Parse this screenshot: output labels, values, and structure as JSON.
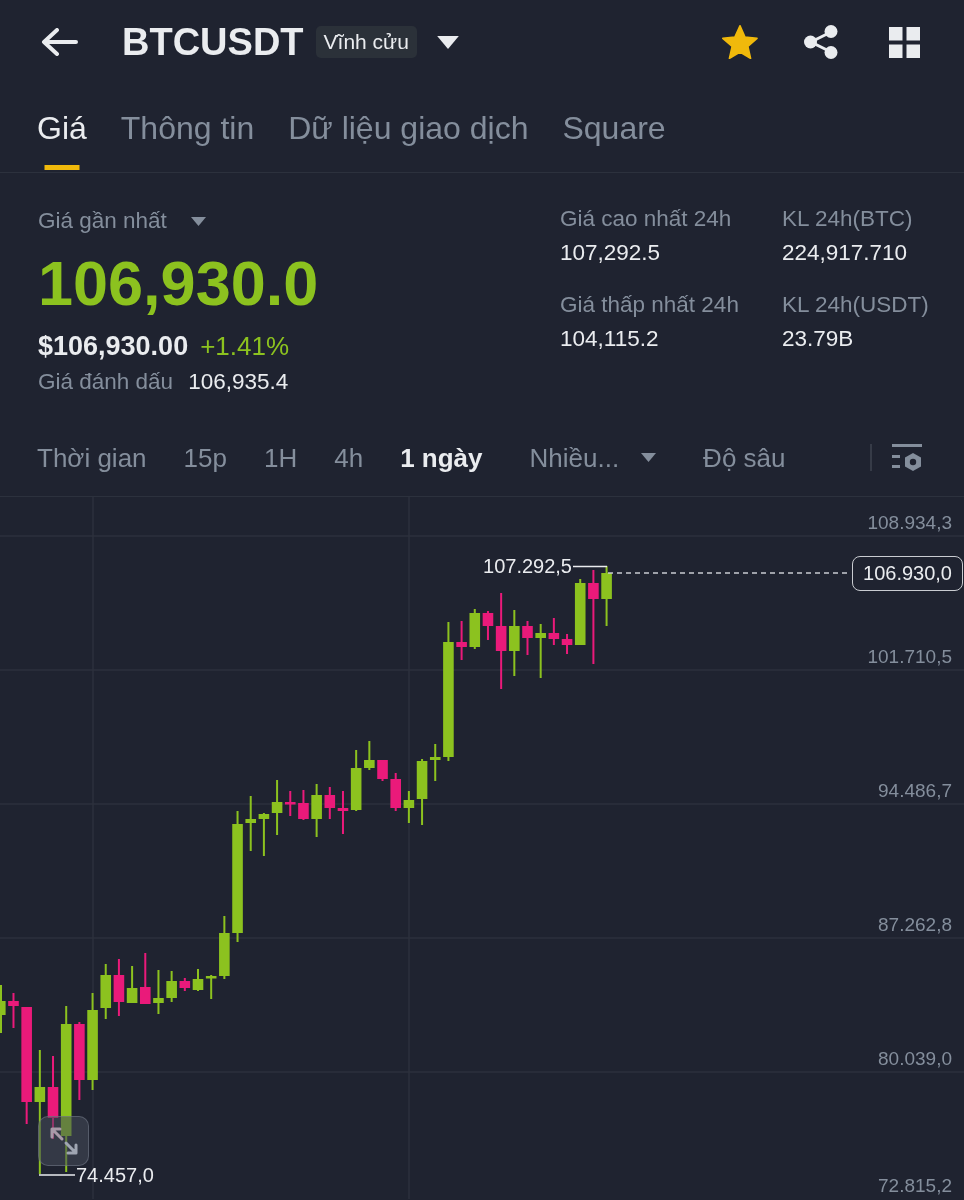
{
  "header": {
    "symbol": "BTCUSDT",
    "contract_type": "Vĩnh cửu",
    "favorite": true
  },
  "tabs": [
    {
      "label": "Giá",
      "selected": true
    },
    {
      "label": "Thông tin",
      "selected": false
    },
    {
      "label": "Dữ liệu giao dịch",
      "selected": false
    },
    {
      "label": "Square",
      "selected": false
    }
  ],
  "price_panel": {
    "last_price_label": "Giá gần nhất",
    "last_price": "106,930.0",
    "usd_price": "$106,930.00",
    "change": "+1.41%",
    "mark_price_label": "Giá đánh dấu",
    "mark_price": "106,935.4"
  },
  "stats": [
    {
      "label": "Giá cao nhất 24h",
      "value": "107,292.5"
    },
    {
      "label": "KL 24h(BTC)",
      "value": "224,917.710"
    },
    {
      "label": "Giá thấp nhất 24h",
      "value": "104,115.2"
    },
    {
      "label": "KL 24h(USDT)",
      "value": "23.79B"
    }
  ],
  "chart_toolbar": [
    {
      "kind": "interval",
      "label": "Thời gian",
      "selected": false
    },
    {
      "kind": "interval",
      "label": "15p",
      "selected": false
    },
    {
      "kind": "interval",
      "label": "1H",
      "selected": false
    },
    {
      "kind": "interval",
      "label": "4h",
      "selected": false
    },
    {
      "kind": "interval",
      "label": "1 ngày",
      "selected": true
    },
    {
      "kind": "dropdown",
      "label": "Nhiều...",
      "selected": false
    },
    {
      "kind": "view",
      "label": "Độ sâu",
      "selected": false
    }
  ],
  "chart": {
    "price_axis": [
      "108.934,3",
      "101.710,5",
      "94.486,7",
      "87.262,8",
      "80.039,0",
      "72.815,2"
    ],
    "high_marker": "107.292,5",
    "low_marker": "74.457,0",
    "last_price_tag": "106.930,0"
  }
}
